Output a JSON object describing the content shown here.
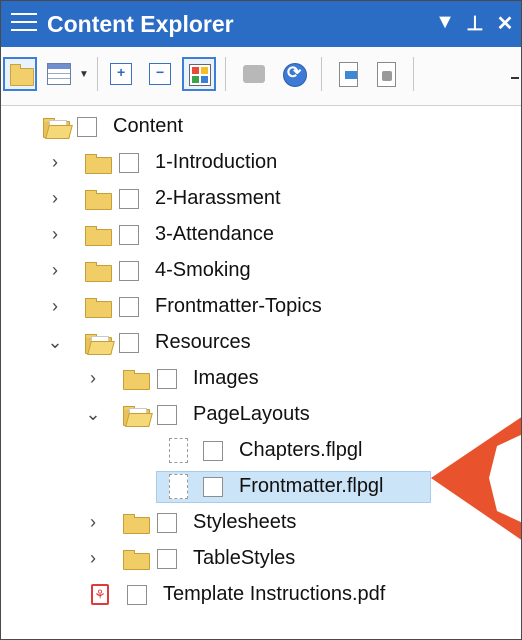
{
  "panel": {
    "title": "Content Explorer",
    "title_controls": [
      {
        "name": "dropdown-icon",
        "glyph": "▼"
      },
      {
        "name": "pin-icon",
        "glyph": "⊥"
      },
      {
        "name": "close-icon",
        "glyph": "✕"
      }
    ]
  },
  "toolbar": {
    "buttons": [
      {
        "name": "show-folders-button",
        "icon": "folder-icon",
        "pressed": true
      },
      {
        "name": "view-options-button",
        "icon": "table-icon",
        "pressed": false,
        "has_dropdown": true
      },
      {
        "name": "expand-all-button",
        "icon": "expand-icon",
        "pressed": false
      },
      {
        "name": "collapse-all-button",
        "icon": "collapse-icon",
        "pressed": false
      },
      {
        "name": "show-files-button",
        "icon": "grid-icon",
        "pressed": true
      },
      {
        "name": "disabled-action-button",
        "icon": "gray-arrow-icon",
        "pressed": false
      },
      {
        "name": "refresh-button",
        "icon": "refresh-icon",
        "pressed": false
      },
      {
        "name": "open-document-button",
        "icon": "document-icon",
        "pressed": false
      },
      {
        "name": "properties-button",
        "icon": "properties-icon",
        "pressed": false
      }
    ],
    "expand_glyph": "+",
    "collapse_glyph": "−",
    "grid_colors": [
      "#e84b3c",
      "#f4c029",
      "#3aa34b",
      "#3e7fd6"
    ]
  },
  "tree": [
    {
      "label": "Content",
      "type": "folder-open",
      "level": 0,
      "chevron": ""
    },
    {
      "label": "1-Introduction",
      "type": "folder",
      "level": 1,
      "chevron": "›"
    },
    {
      "label": "2-Harassment",
      "type": "folder",
      "level": 1,
      "chevron": "›"
    },
    {
      "label": "3-Attendance",
      "type": "folder",
      "level": 1,
      "chevron": "›"
    },
    {
      "label": "4-Smoking",
      "type": "folder",
      "level": 1,
      "chevron": "›"
    },
    {
      "label": "Frontmatter-Topics",
      "type": "folder",
      "level": 1,
      "chevron": "›"
    },
    {
      "label": "Resources",
      "type": "folder-open",
      "level": 1,
      "chevron": "⌄"
    },
    {
      "label": "Images",
      "type": "folder",
      "level": 2,
      "chevron": "›"
    },
    {
      "label": "PageLayouts",
      "type": "folder-open",
      "level": 2,
      "chevron": "⌄"
    },
    {
      "label": "Chapters.flpgl",
      "type": "file",
      "level": 3,
      "chevron": ""
    },
    {
      "label": "Frontmatter.flpgl",
      "type": "file",
      "level": 3,
      "chevron": "",
      "selected": true
    },
    {
      "label": "Stylesheets",
      "type": "folder",
      "level": 2,
      "chevron": "›"
    },
    {
      "label": "TableStyles",
      "type": "folder",
      "level": 2,
      "chevron": "›"
    },
    {
      "label": "Template Instructions.pdf",
      "type": "pdf",
      "level": 1,
      "chevron": ""
    }
  ],
  "colors": {
    "titlebar": "#2b6cc4",
    "selection": "#cce4f7",
    "callout": "#e8532d",
    "folder": "#f0cd66"
  }
}
